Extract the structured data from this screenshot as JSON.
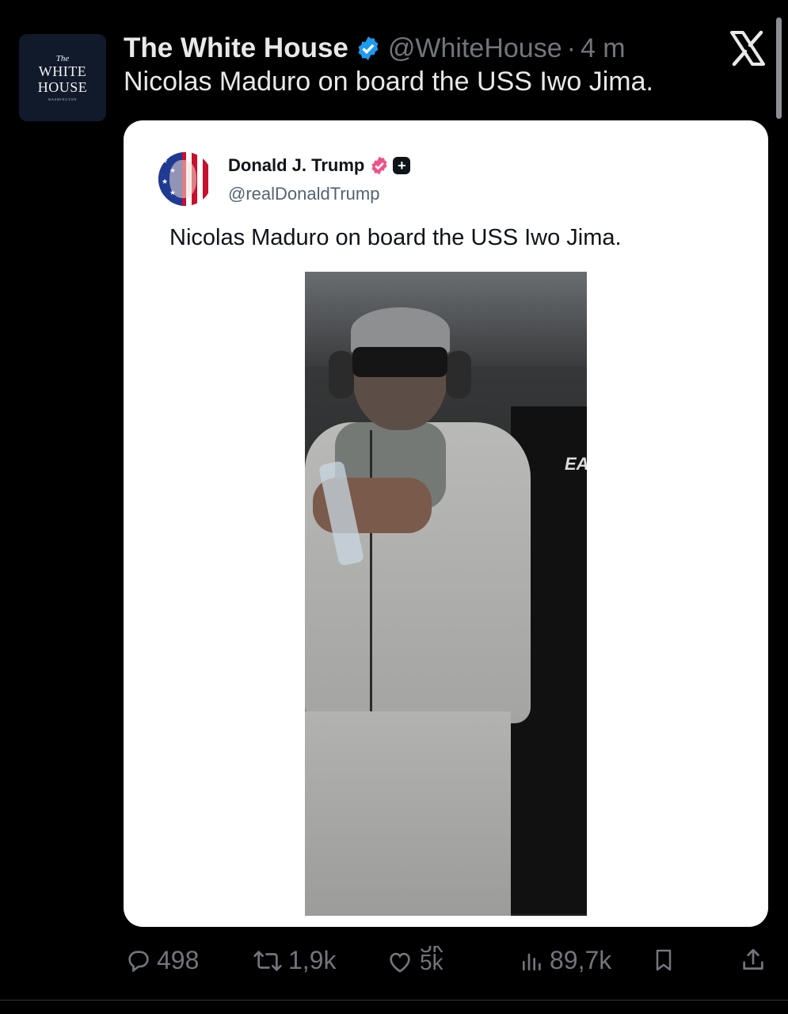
{
  "post": {
    "avatar": {
      "line1": "The",
      "line2": "WHITE",
      "line3": "HOUSE",
      "line4": "WASHINGTON"
    },
    "display_name": "The White House",
    "handle": "@WhiteHouse",
    "separator": "·",
    "time": "4 m",
    "text": "Nicolas Maduro on board the USS Iwo Jima."
  },
  "quoted": {
    "display_name": "Donald J. Trump",
    "handle": "@realDonaldTrump",
    "text": "Nicolas Maduro on board the USS Iwo Jima.",
    "photo_overlay_text": "EA"
  },
  "actions": {
    "replies": "498",
    "reposts": "1,9k",
    "likes_top": "5k",
    "likes_bottom": "5k",
    "views": "89,7k"
  },
  "colors": {
    "verified": "#1d9bf0",
    "quoted_badge": "#f0508a",
    "text_muted": "#71767b"
  },
  "icons": [
    "x-logo-icon",
    "verified-badge-icon",
    "reply-icon",
    "repost-icon",
    "like-icon",
    "views-icon",
    "bookmark-icon",
    "share-icon"
  ]
}
